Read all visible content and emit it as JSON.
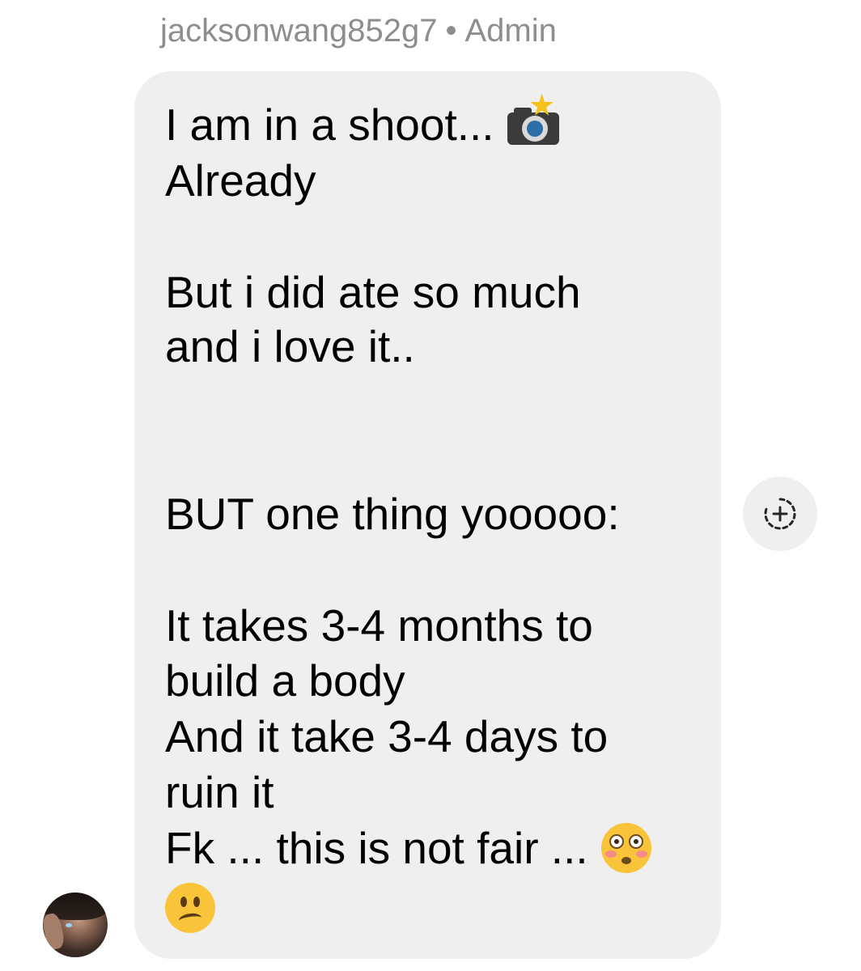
{
  "sender": {
    "username": "jacksonwang852g7",
    "separator": "•",
    "role": "Admin"
  },
  "message": {
    "lines": [
      "I am in a shoot...",
      "Already",
      "But i did ate so much",
      "and i love it..",
      "BUT one thing yooooo:",
      "It takes 3-4 months to",
      "build a body",
      "And it take 3-4 days to",
      "ruin it",
      "Fk ... this is not fair ..."
    ],
    "emojis": [
      "camera-with-flash",
      "flushed-face",
      "confused-face"
    ]
  },
  "reaction_button": {
    "icon": "add-reaction-icon"
  },
  "avatar": {
    "icon": "profile-photo"
  },
  "colors": {
    "bubble": "#efefef",
    "meta_text": "#8e8e8e",
    "text": "#000000",
    "icon": "#262626"
  }
}
